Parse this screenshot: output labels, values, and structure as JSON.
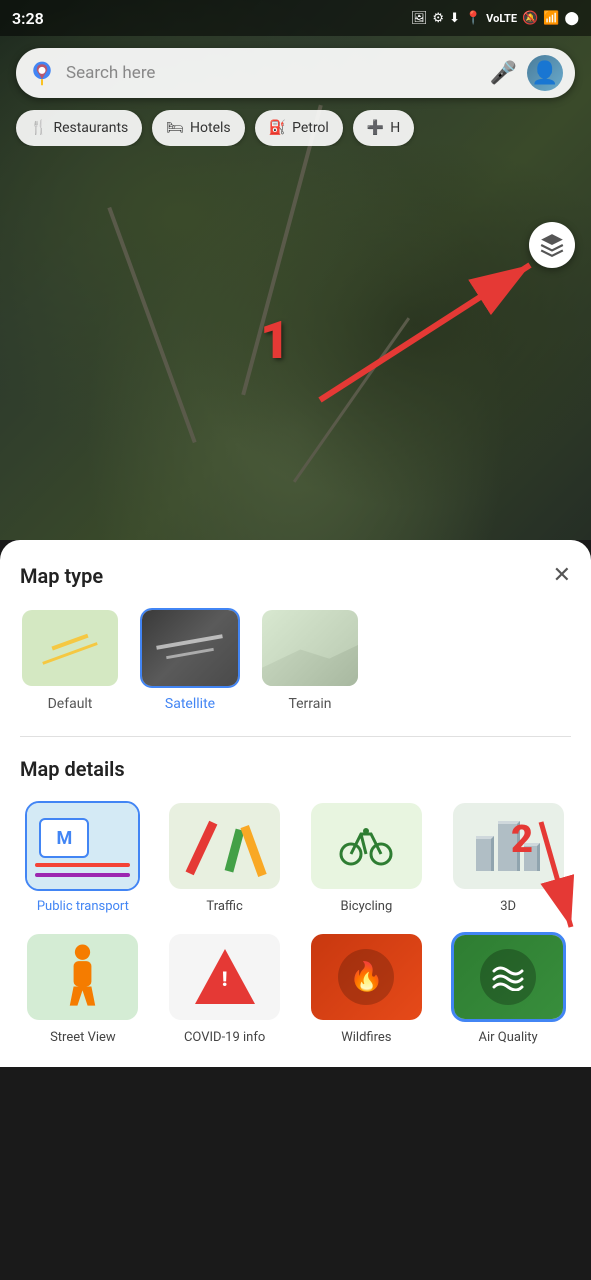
{
  "statusBar": {
    "time": "3:28",
    "icons": [
      "photo",
      "settings",
      "download",
      "location",
      "volte",
      "mute",
      "4g",
      "signal",
      "battery"
    ]
  },
  "searchBar": {
    "placeholder": "Search here",
    "micLabel": "mic",
    "avatarLabel": "user avatar"
  },
  "chips": [
    {
      "icon": "🍴",
      "label": "Restaurants"
    },
    {
      "icon": "🛏",
      "label": "Hotels"
    },
    {
      "icon": "⛽",
      "label": "Petrol"
    },
    {
      "icon": "+",
      "label": "H"
    }
  ],
  "layerButton": {
    "icon": "⊕",
    "label": "layers"
  },
  "annotation1": {
    "number": "1"
  },
  "mapTypeSection": {
    "title": "Map type",
    "closeLabel": "×",
    "types": [
      {
        "id": "default",
        "label": "Default",
        "selected": false
      },
      {
        "id": "satellite",
        "label": "Satellite",
        "selected": true
      },
      {
        "id": "terrain",
        "label": "Terrain",
        "selected": false
      }
    ]
  },
  "mapDetailsSection": {
    "title": "Map details",
    "items": [
      {
        "id": "transport",
        "label": "Public transport",
        "selected": true
      },
      {
        "id": "traffic",
        "label": "Traffic",
        "selected": false
      },
      {
        "id": "bicycling",
        "label": "Bicycling",
        "selected": false
      },
      {
        "id": "3d",
        "label": "3D",
        "selected": false
      },
      {
        "id": "streetview",
        "label": "Street View",
        "selected": false
      },
      {
        "id": "covid",
        "label": "COVID-19 info",
        "selected": false
      },
      {
        "id": "wildfires",
        "label": "Wildfires",
        "selected": false
      },
      {
        "id": "airquality",
        "label": "Air Quality",
        "selected": false
      }
    ]
  },
  "annotation2": {
    "number": "2"
  }
}
